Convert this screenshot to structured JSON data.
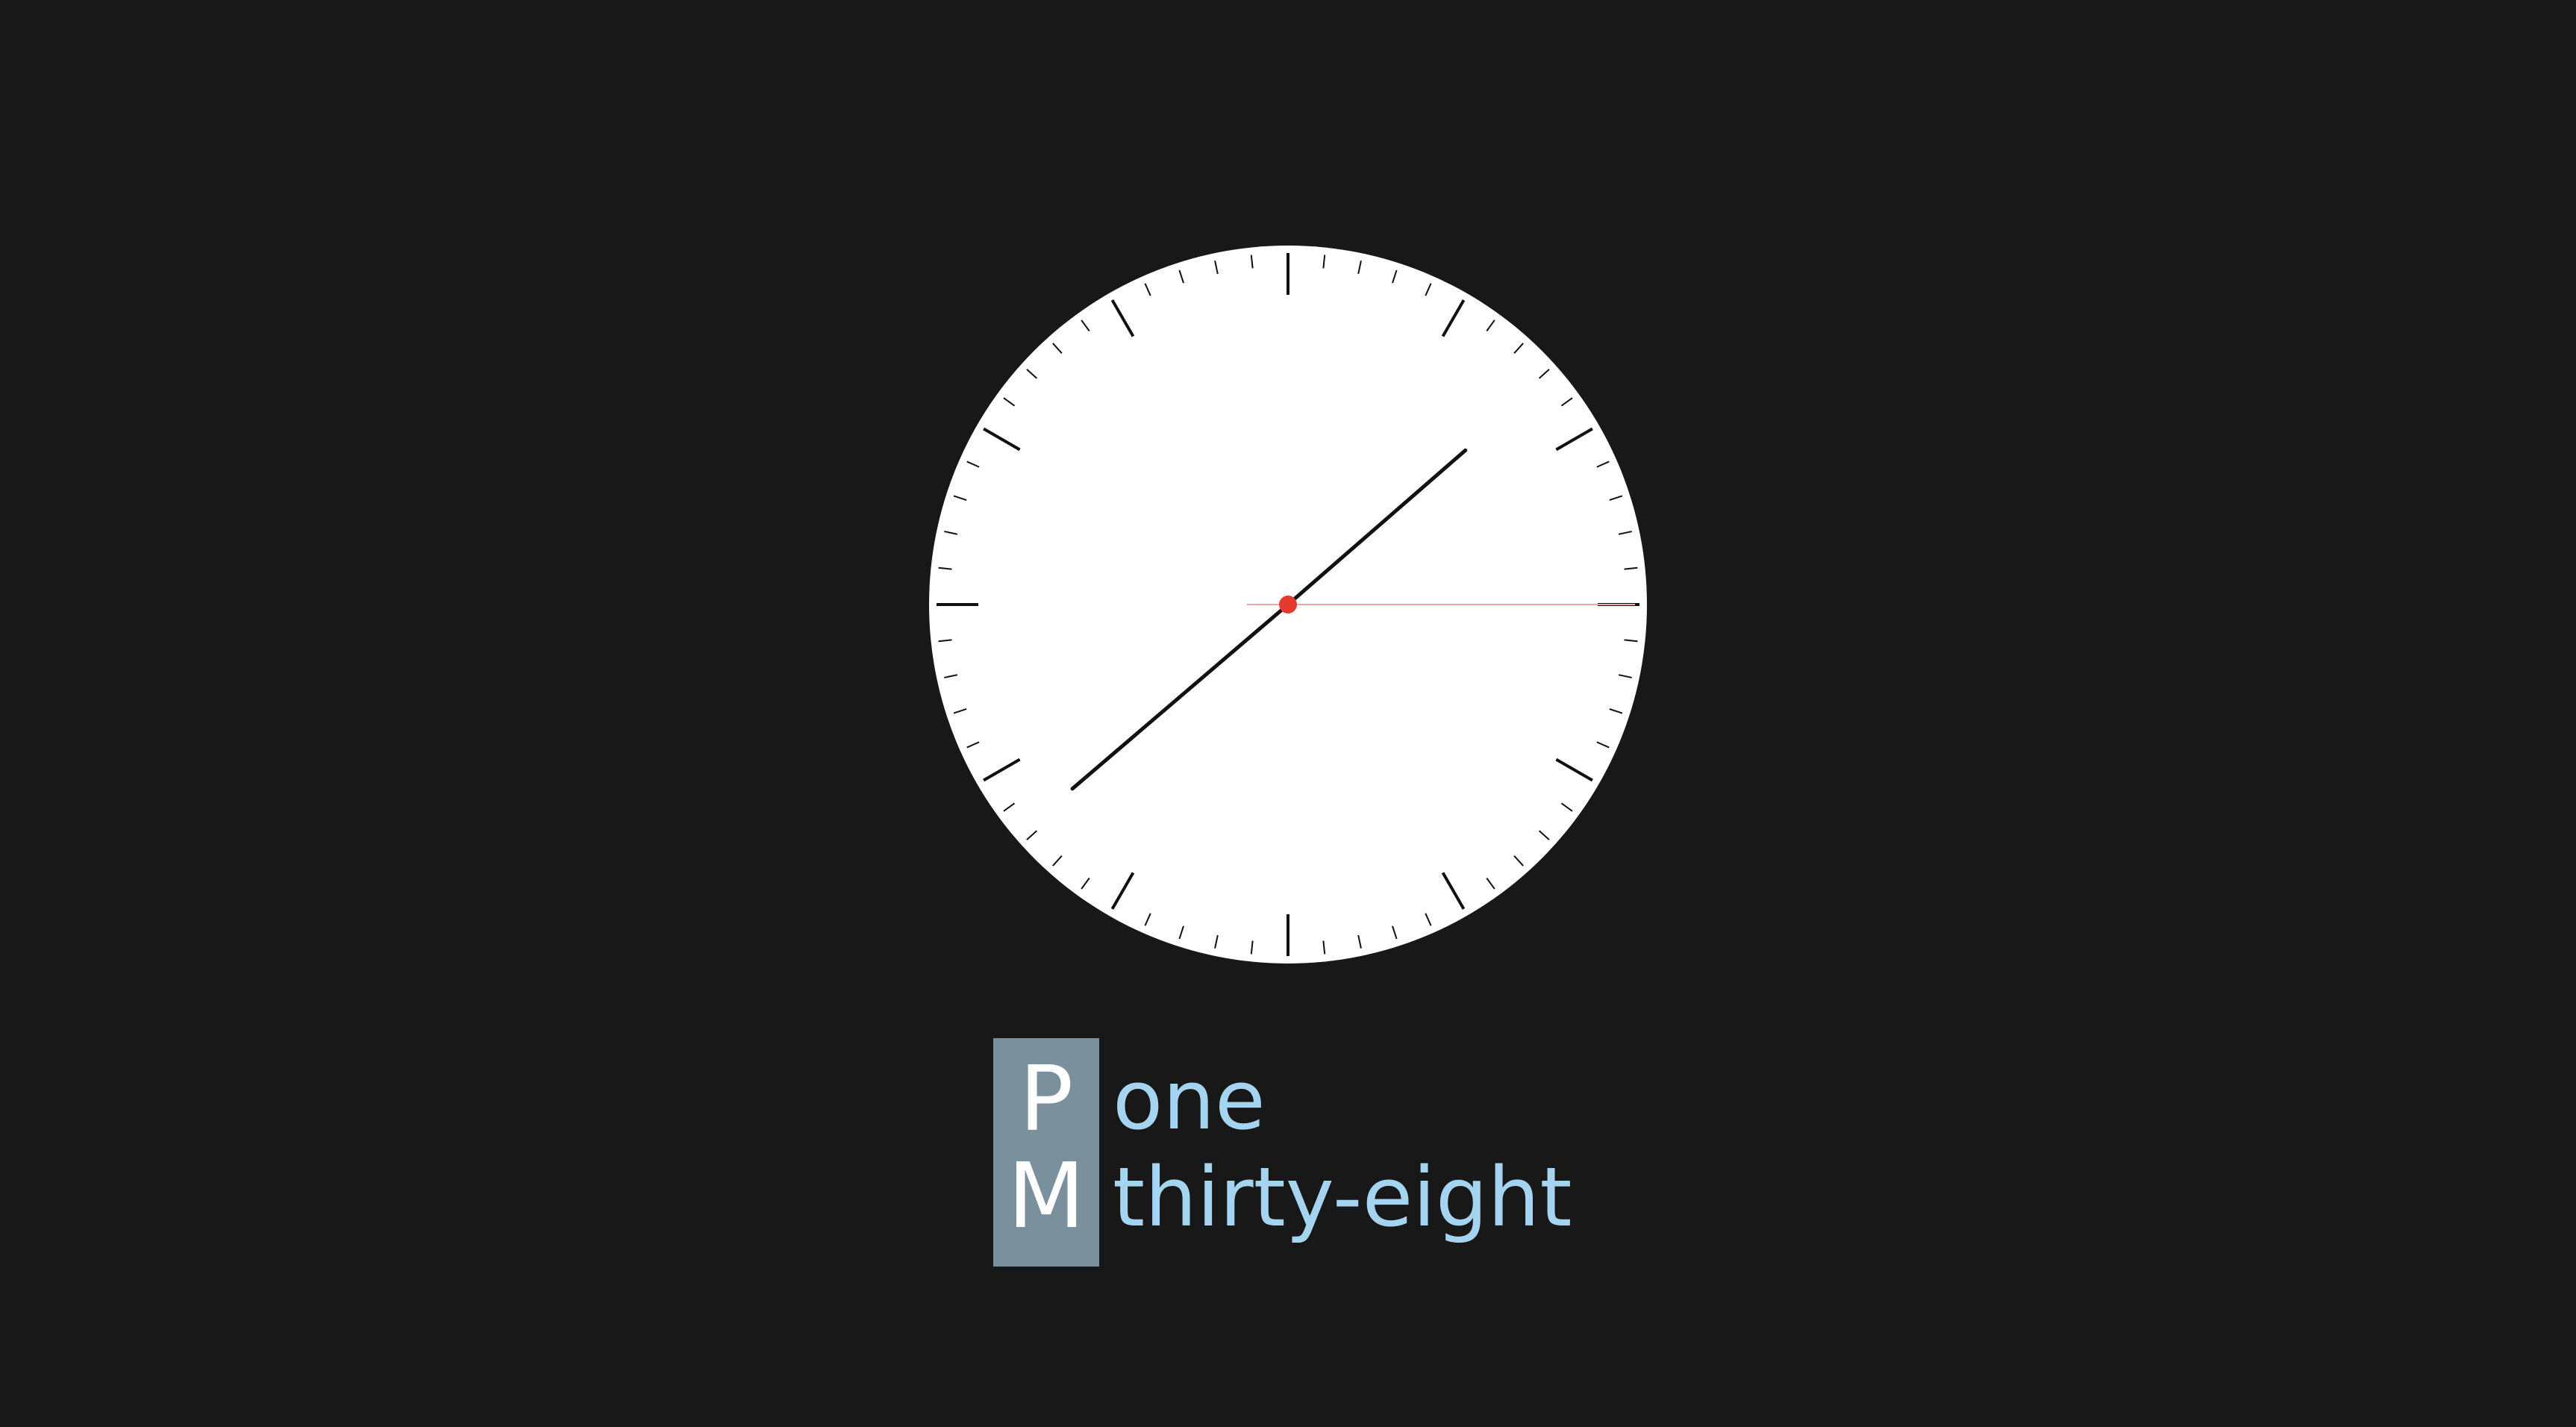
{
  "time": {
    "hours": 13,
    "minutes": 38,
    "seconds": 15
  },
  "clock_face": {
    "face_color": "#ffffff",
    "hand_color": "#111111",
    "second_hand_color": "#f2a4ab",
    "center_color": "#e53a2f"
  },
  "ampm": {
    "top_letter": "P",
    "bottom_letter": "M",
    "badge_color": "#7b909d"
  },
  "words": {
    "hour": "one",
    "minutes": "thirty-eight"
  },
  "colors": {
    "background": "#181818",
    "word_color": "#a5d4f1"
  }
}
